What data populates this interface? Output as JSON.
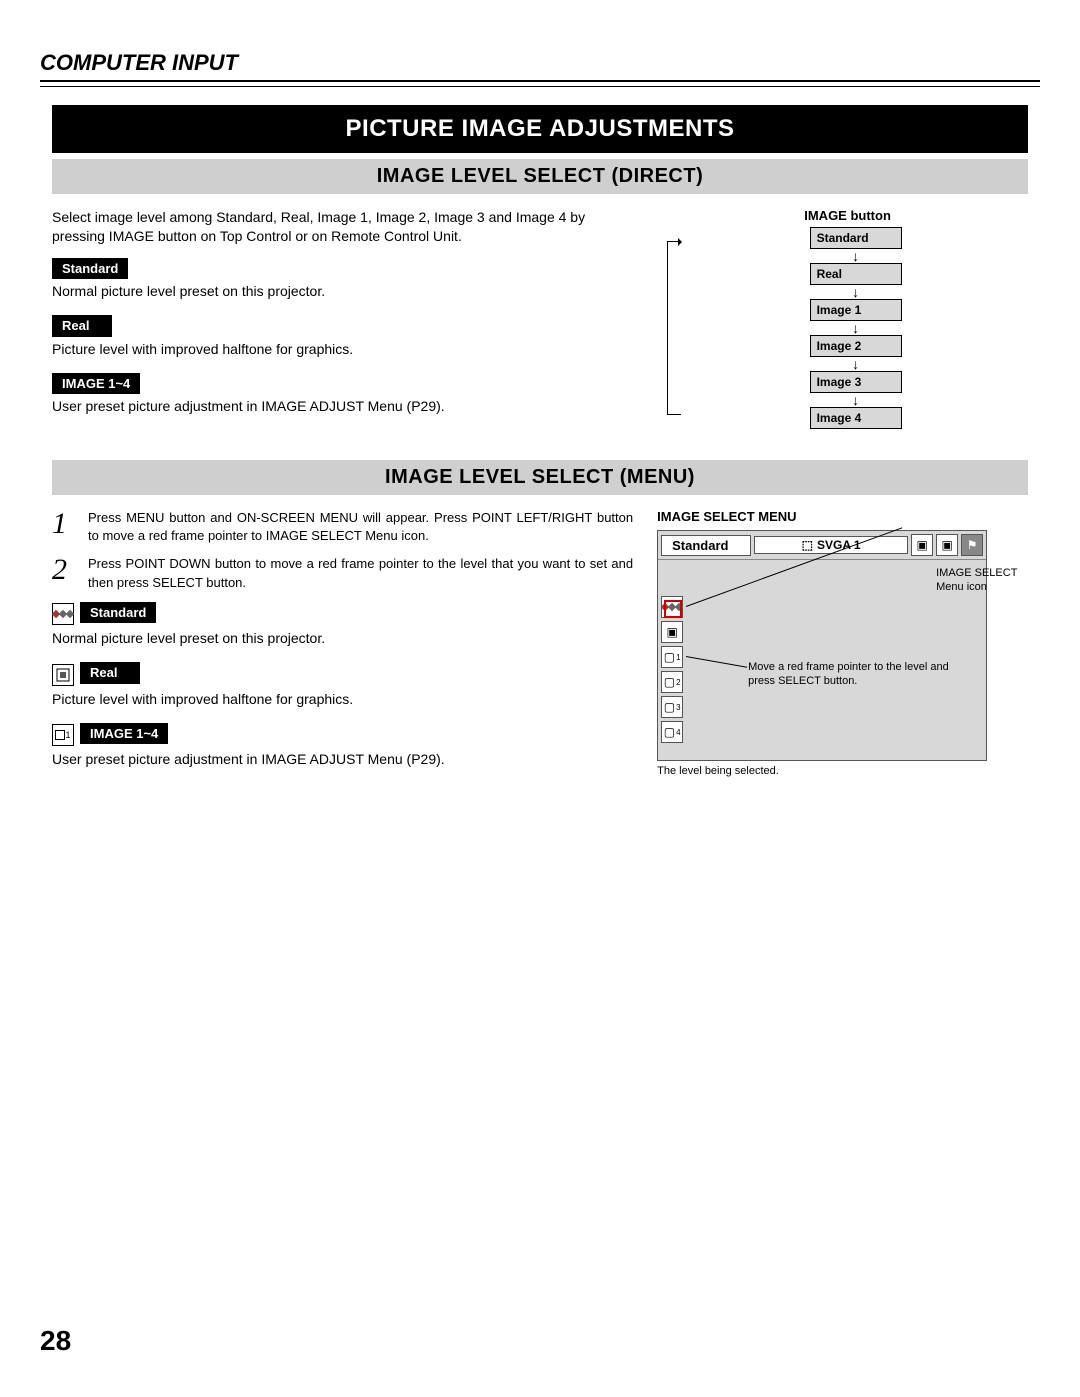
{
  "header": "COMPUTER INPUT",
  "title": "PICTURE IMAGE ADJUSTMENTS",
  "section1": {
    "heading": "IMAGE LEVEL SELECT (DIRECT)",
    "intro": "Select image level among Standard, Real, Image 1, Image 2, Image 3 and Image 4 by pressing IMAGE button on Top Control or on Remote Control Unit.",
    "items": [
      {
        "tag": "Standard",
        "desc": "Normal picture level preset on this projector."
      },
      {
        "tag": "Real",
        "desc": "Picture level with improved halftone for graphics."
      },
      {
        "tag": "IMAGE 1~4",
        "desc": "User preset picture adjustment in IMAGE ADJUST Menu (P29)."
      }
    ],
    "diagram": {
      "title": "IMAGE button",
      "levels": [
        "Standard",
        "Real",
        "Image 1",
        "Image 2",
        "Image 3",
        "Image 4"
      ]
    }
  },
  "section2": {
    "heading": "IMAGE LEVEL SELECT (MENU)",
    "steps": [
      "Press MENU button and ON-SCREEN MENU will appear.  Press POINT LEFT/RIGHT button to move a red frame pointer to IMAGE SELECT Menu icon.",
      "Press POINT DOWN button to move a red frame pointer to the level that you want to set and then press SELECT button."
    ],
    "items": [
      {
        "tag": "Standard",
        "desc": "Normal picture level preset on this projector."
      },
      {
        "tag": "Real",
        "desc": "Picture level with improved halftone for graphics."
      },
      {
        "tag": "IMAGE 1~4",
        "desc": "User preset picture adjustment in IMAGE ADJUST Menu (P29)."
      }
    ],
    "osd": {
      "title": "IMAGE SELECT MENU",
      "label": "Standard",
      "mode": "SVGA 1",
      "callout1": "IMAGE SELECT Menu icon",
      "callout2": "Move a red frame pointer to the level and press SELECT button.",
      "note": "The level being selected."
    }
  },
  "page_number": "28"
}
